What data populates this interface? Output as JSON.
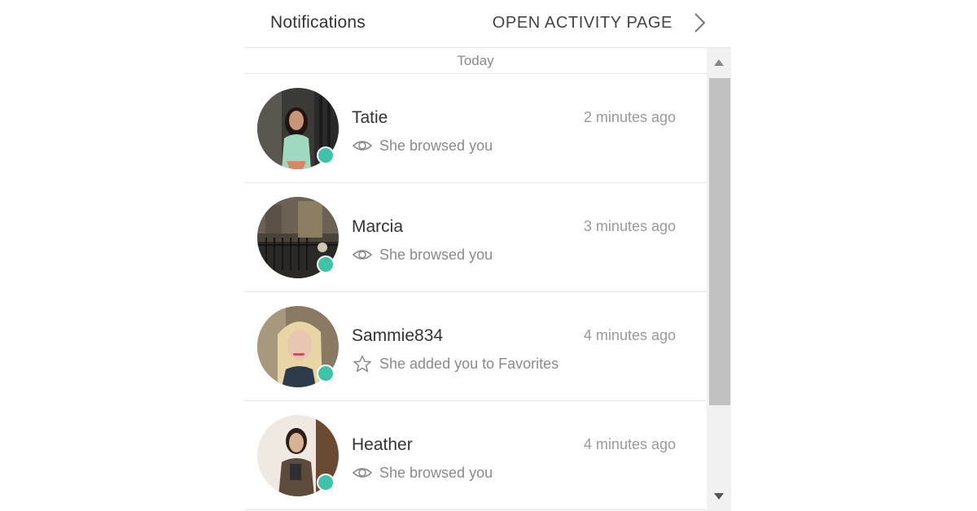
{
  "header": {
    "title": "Notifications",
    "open_activity_label": "OPEN ACTIVITY PAGE"
  },
  "list": {
    "day_label": "Today",
    "items": [
      {
        "name": "Tatie",
        "time": "2 minutes ago",
        "activity": "She browsed you",
        "activity_icon": "eye-icon",
        "online": true
      },
      {
        "name": "Marcia",
        "time": "3 minutes ago",
        "activity": "She browsed you",
        "activity_icon": "eye-icon",
        "online": true
      },
      {
        "name": "Sammie834",
        "time": "4 minutes ago",
        "activity": "She added you to Favorites",
        "activity_icon": "star-icon",
        "online": true
      },
      {
        "name": "Heather",
        "time": "4 minutes ago",
        "activity": "She browsed you",
        "activity_icon": "eye-icon",
        "online": true
      }
    ]
  },
  "colors": {
    "online_dot": "#3fc3a8",
    "text_primary": "#333333",
    "text_secondary": "#8a8a8a",
    "scrollbar_thumb": "#c1c1c1",
    "scrollbar_track": "#f1f1f1"
  }
}
